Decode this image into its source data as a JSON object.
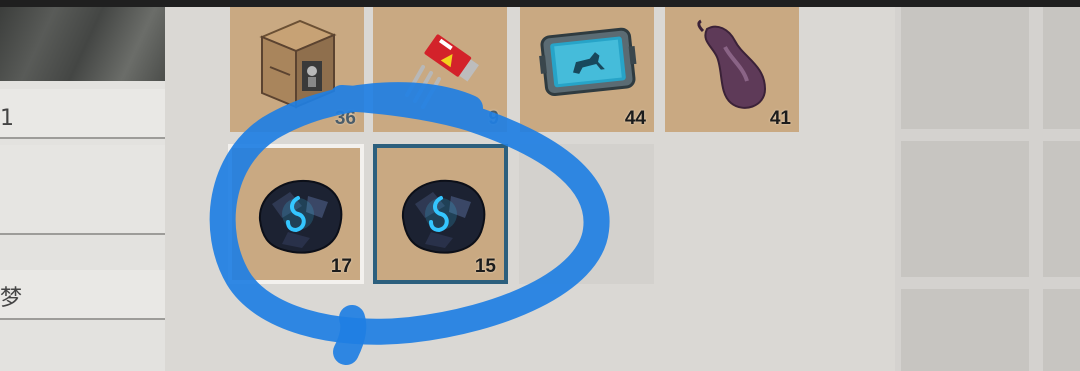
{
  "left_panel": {
    "rows": [
      {
        "text": "1"
      },
      {
        "text": ""
      },
      {
        "text": "梦"
      }
    ]
  },
  "inventory": {
    "slots": [
      {
        "item": "supply-crate-icon",
        "count": "36"
      },
      {
        "item": "electronic-component-icon",
        "count": "9"
      },
      {
        "item": "tablet-device-icon",
        "count": "44"
      },
      {
        "item": "organic-meat-icon",
        "count": "41"
      },
      {
        "item": "dark-crystal-ore-icon",
        "count": "17"
      },
      {
        "item": "dark-crystal-ore-icon",
        "count": "15",
        "selected": true
      },
      {
        "item": "",
        "count": ""
      }
    ]
  },
  "annotation": {
    "color": "#1f7fe3"
  }
}
